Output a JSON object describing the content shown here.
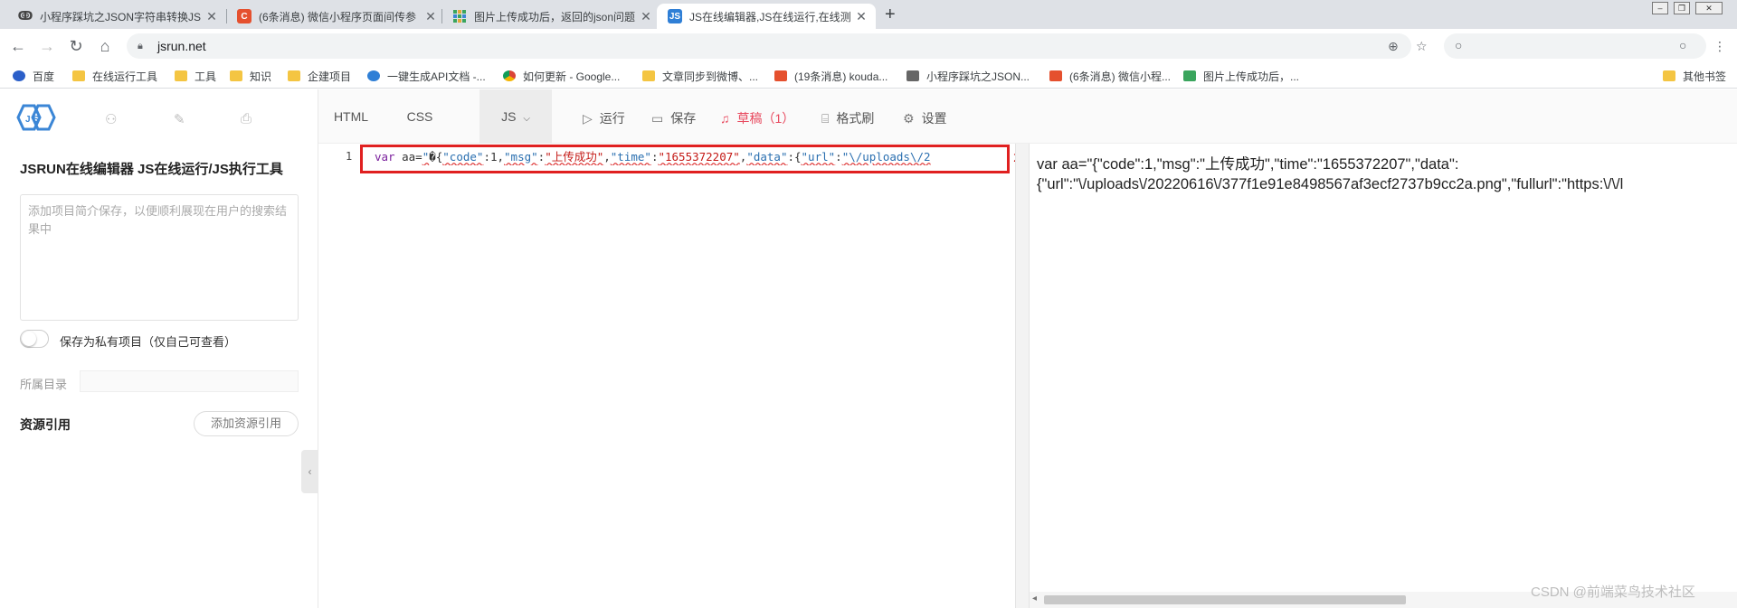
{
  "browser": {
    "tabs": [
      {
        "title": "小程序踩坑之JSON字符串转换JS",
        "close": "✕",
        "icon": "ribbon-icon"
      },
      {
        "title": "(6条消息) 微信小程序页面间传参",
        "close": "✕",
        "icon": "csdn-icon"
      },
      {
        "title": "图片上传成功后，返回的json问题",
        "close": "✕",
        "icon": "grid-icon"
      },
      {
        "title": "JS在线编辑器,JS在线运行,在线测",
        "close": "✕",
        "icon": "jsrun-icon"
      }
    ],
    "new_tab": "+",
    "url": "jsrun.net"
  },
  "bookmarks": [
    {
      "label": "百度",
      "icon": "paw-icon"
    },
    {
      "label": "在线运行工具",
      "icon": "folder-icon"
    },
    {
      "label": "工具",
      "icon": "folder-icon"
    },
    {
      "label": "知识",
      "icon": "folder-icon"
    },
    {
      "label": "企建项目",
      "icon": "folder-icon"
    },
    {
      "label": "一键生成API文档 -...",
      "icon": "bolt-icon"
    },
    {
      "label": "如何更新 - Google...",
      "icon": "chrome-icon"
    },
    {
      "label": "文章同步到微博、...",
      "icon": "folder-icon"
    },
    {
      "label": "(19条消息) kouda...",
      "icon": "csdn-icon"
    },
    {
      "label": "小程序踩坑之JSON...",
      "icon": "ribbon-icon"
    },
    {
      "label": "(6条消息) 微信小程...",
      "icon": "csdn-icon"
    },
    {
      "label": "图片上传成功后，...",
      "icon": "grid-icon"
    },
    {
      "label": "其他书签",
      "icon": "folder-icon"
    }
  ],
  "sidebar": {
    "title": "JSRUN在线编辑器 JS在线运行/JS执行工具",
    "desc_placeholder": "添加项目简介保存，以便顺利展现在用户的搜索结果中",
    "private_label": "保存为私有项目（仅自己可查看）",
    "dir_label": "所属目录",
    "resource_title": "资源引用",
    "add_resource": "添加资源引用"
  },
  "toolbar": {
    "tabs": [
      "HTML",
      "CSS",
      "JS"
    ],
    "run": "运行",
    "save": "保存",
    "draft": "草稿（1）",
    "format": "格式刷",
    "settings": "设置"
  },
  "editor": {
    "line_number": "1",
    "code": {
      "kw": "var",
      "name": " aa=",
      "q1": "\"",
      "bad": "�",
      "p1": "{",
      "k1": "\"code\"",
      "v1": ":1,",
      "k2": "\"msg\"",
      "c2": ":",
      "v2": "\"上传成功\"",
      "c3": ",",
      "k3": "\"time\"",
      "c4": ":",
      "v3": "\"1655372207\"",
      "c5": ",",
      "k4": "\"data\"",
      "c6": ":{",
      "k5": "\"url\"",
      "c7": ":",
      "v5": "\"\\/uploads\\/2"
    },
    "overflow_char": "2"
  },
  "result": {
    "line1": "var aa=\"{\"code\":1,\"msg\":\"上传成功\",\"time\":\"1655372207\",\"data\":",
    "line2": "{\"url\":\"\\/uploads\\/20220616\\/377f1e91e8498567af3ecf2737b9cc2a.png\",\"fullurl\":\"https:\\/\\/l"
  },
  "watermark": "CSDN @前端菜鸟技术社区",
  "colors": {
    "accent": "#3b86d6",
    "draft": "#e84a5f",
    "highlight": "#e02020"
  }
}
